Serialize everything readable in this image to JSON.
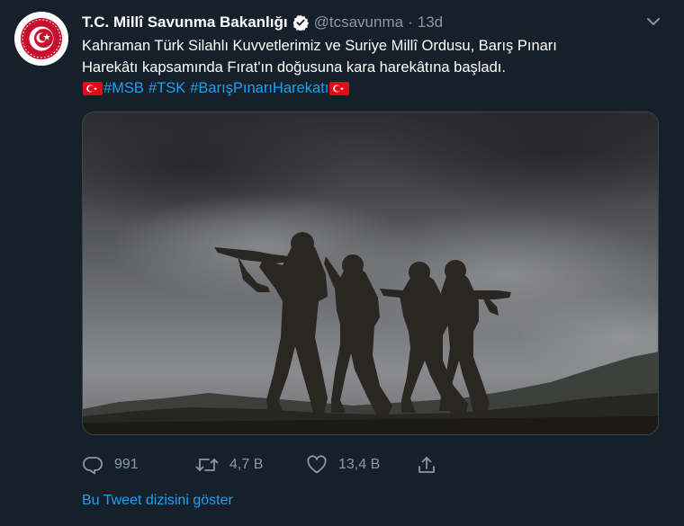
{
  "tweet": {
    "display_name": "T.C. Millî Savunma Bakanlığı",
    "handle": "@tcsavunma",
    "separator": "·",
    "time": "13d",
    "text_line1": "Kahraman Türk Silahlı Kuvvetlerimiz ve Suriye Millî Ordusu, Barış Pınarı",
    "text_line2": "Harekâtı kapsamında Fırat'ın doğusuna kara harekâtına başladı.",
    "hashtags": [
      "#MSB",
      "#TSK",
      "#BarışPınarıHarekatı"
    ],
    "flag_icon": "turkish-flag-emoji",
    "media_icon": "soldiers-silhouette-photo"
  },
  "actions": {
    "reply_count": "991",
    "retweet_count": "4,7 B",
    "like_count": "13,4 B",
    "reply_icon": "reply-icon",
    "retweet_icon": "retweet-icon",
    "like_icon": "heart-icon",
    "share_icon": "share-icon"
  },
  "thread_link": "Bu Tweet dizisini göster",
  "colors": {
    "background": "#15202b",
    "accent": "#1da1f2",
    "secondary_text": "#8899a6",
    "flag_red": "#e30a17"
  }
}
